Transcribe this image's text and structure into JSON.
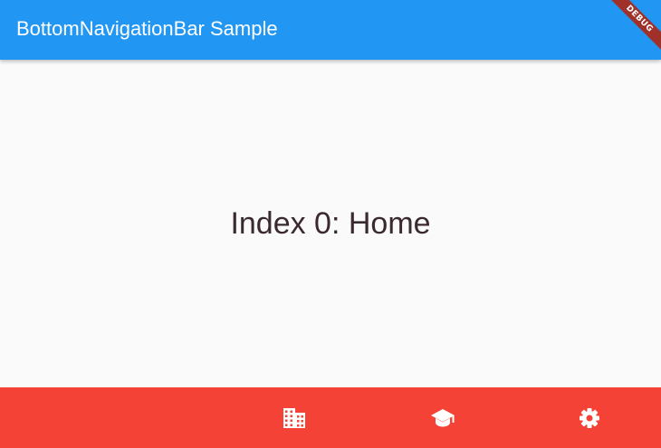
{
  "app_bar": {
    "title": "BottomNavigationBar Sample",
    "background": "#2196f3"
  },
  "debug_banner": {
    "label": "DEBUG"
  },
  "content": {
    "text": "Index 0: Home"
  },
  "bottom_nav": {
    "background": "#f44336",
    "selected_index": 0,
    "items": [
      {
        "icon": "home-icon",
        "visible": false
      },
      {
        "icon": "business-icon"
      },
      {
        "icon": "school-icon"
      },
      {
        "icon": "settings-icon"
      }
    ]
  }
}
